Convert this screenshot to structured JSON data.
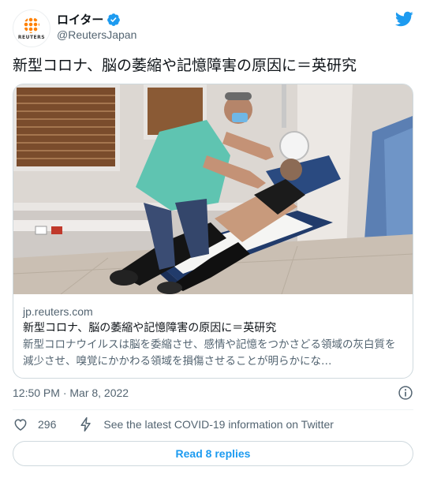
{
  "author": {
    "display_name": "ロイター",
    "handle": "@ReutersJapan",
    "avatar_wordmark": "REUTERS",
    "verified": true
  },
  "tweet": {
    "text": "新型コロナ、脳の萎縮や記憶障害の原因に＝英研究"
  },
  "link_card": {
    "domain": "jp.reuters.com",
    "title": "新型コロナ、脳の萎縮や記憶障害の原因に＝英研究",
    "description": "新型コロナウイルスは脳を委縮させ、感情や記憶をつかさどる領域の灰白質を減少させ、嗅覚にかかわる領域を損傷させることが明らかにな…"
  },
  "meta": {
    "timestamp": "12:50 PM · Mar 8, 2022"
  },
  "actions": {
    "like_count": "296",
    "covid_info": "See the latest COVID-19 information on Twitter"
  },
  "replies": {
    "label": "Read 8 replies"
  },
  "colors": {
    "brand_blue": "#1d9bf0",
    "secondary_text": "#536471",
    "border": "#cfd9de",
    "reuters_orange": "#ff8000"
  },
  "icons": [
    "reuters-logo",
    "verified-badge-icon",
    "twitter-bird-icon",
    "info-icon",
    "heart-icon",
    "lightning-icon"
  ]
}
